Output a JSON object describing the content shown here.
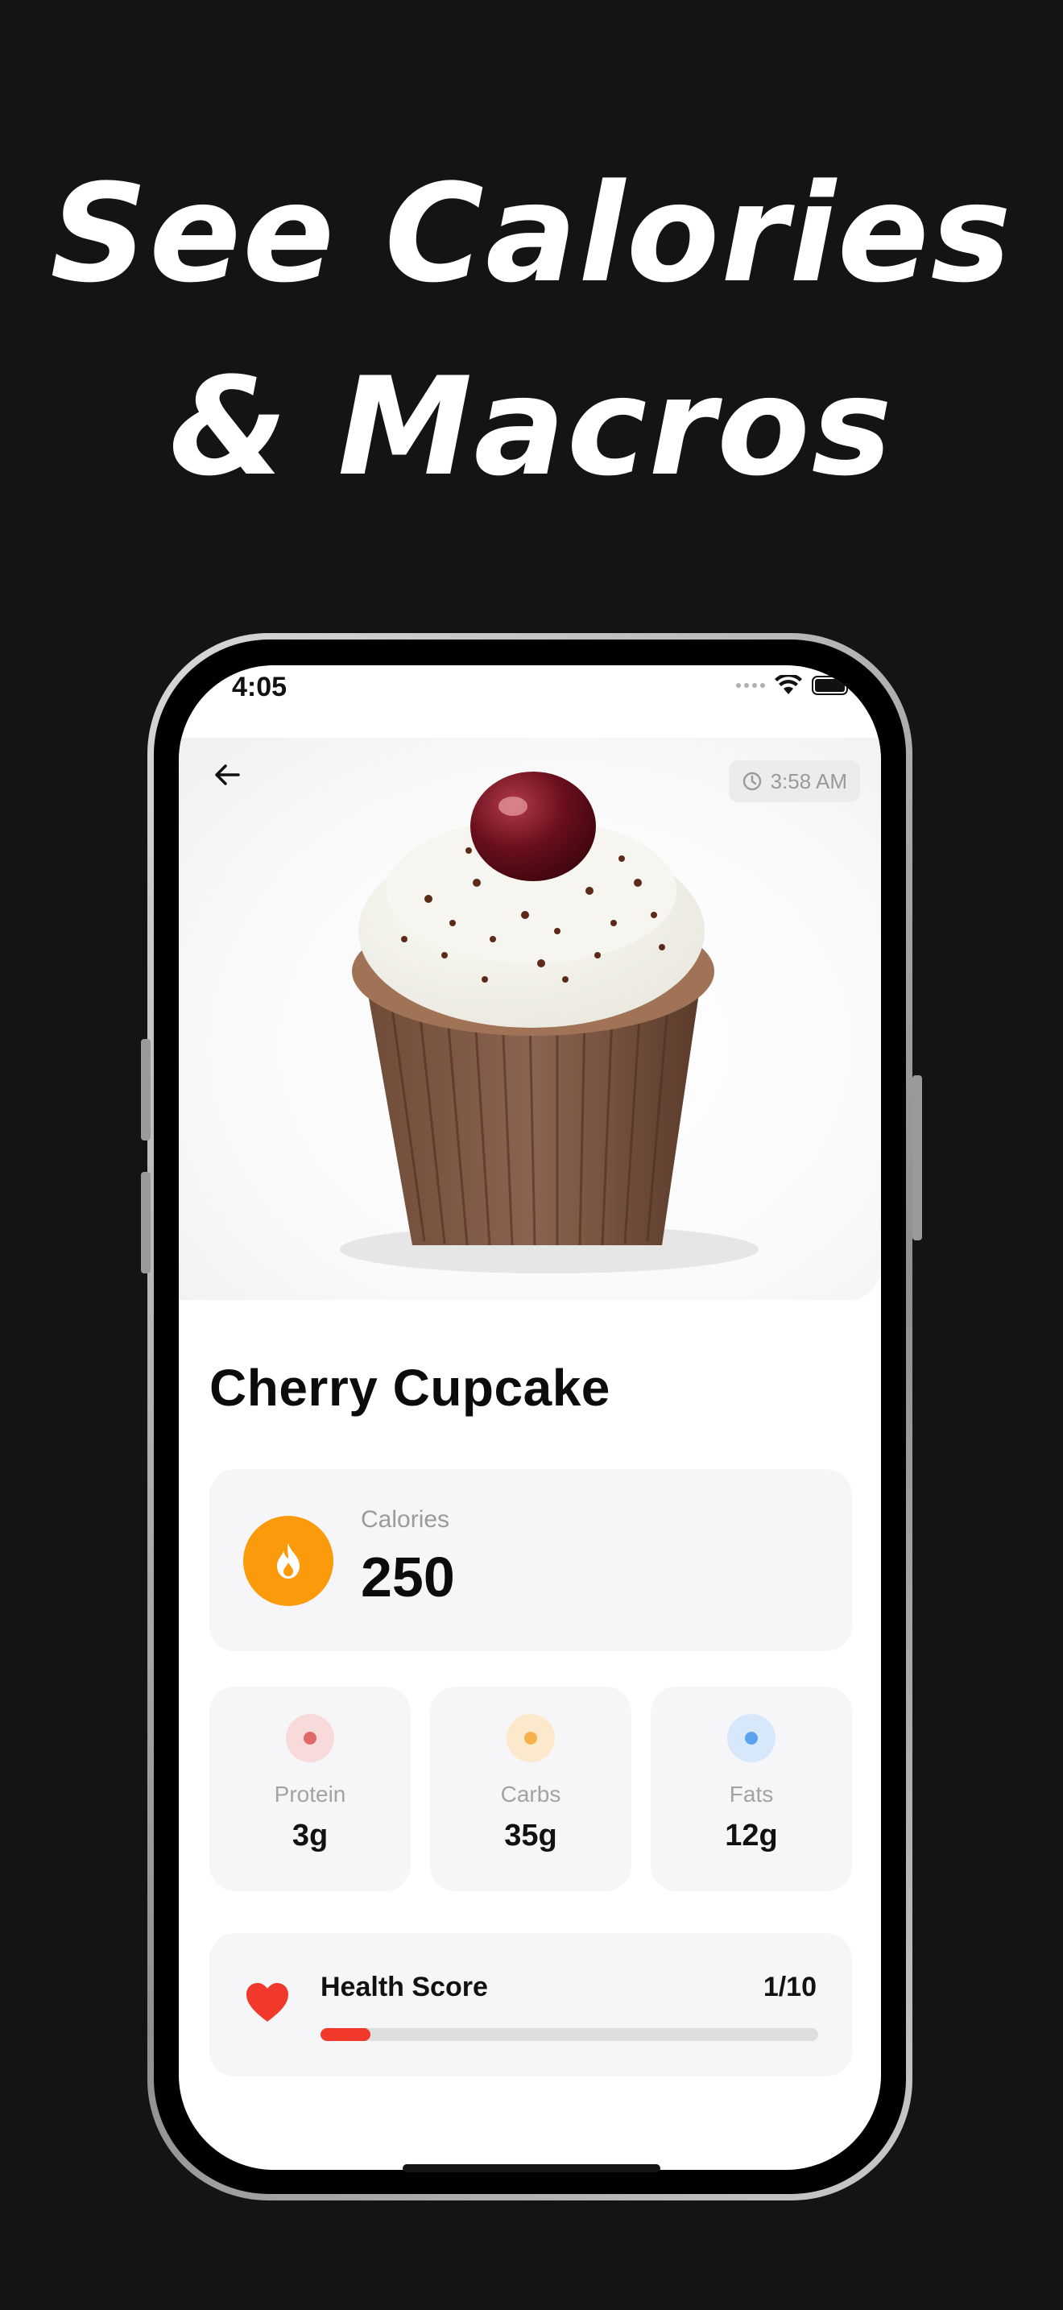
{
  "headline": {
    "line1": "See Calories",
    "line2": "& Macros"
  },
  "status_bar": {
    "time": "4:05"
  },
  "header": {
    "timestamp": "3:58 AM"
  },
  "food": {
    "name": "Cherry Cupcake"
  },
  "calories": {
    "label": "Calories",
    "value": "250",
    "icon": "flame-icon",
    "color": "#FB9A0B"
  },
  "macros": [
    {
      "label": "Protein",
      "value": "3g",
      "color": "#E06A6A",
      "bg": "#F8DADA"
    },
    {
      "label": "Carbs",
      "value": "35g",
      "color": "#F7B24A",
      "bg": "#FCE9CC"
    },
    {
      "label": "Fats",
      "value": "12g",
      "color": "#5AA2EE",
      "bg": "#D8E8FB"
    }
  ],
  "health_score": {
    "label": "Health Score",
    "value": "1/10",
    "score": 1,
    "max": 10,
    "icon": "heart-icon",
    "color": "#F0392B"
  }
}
